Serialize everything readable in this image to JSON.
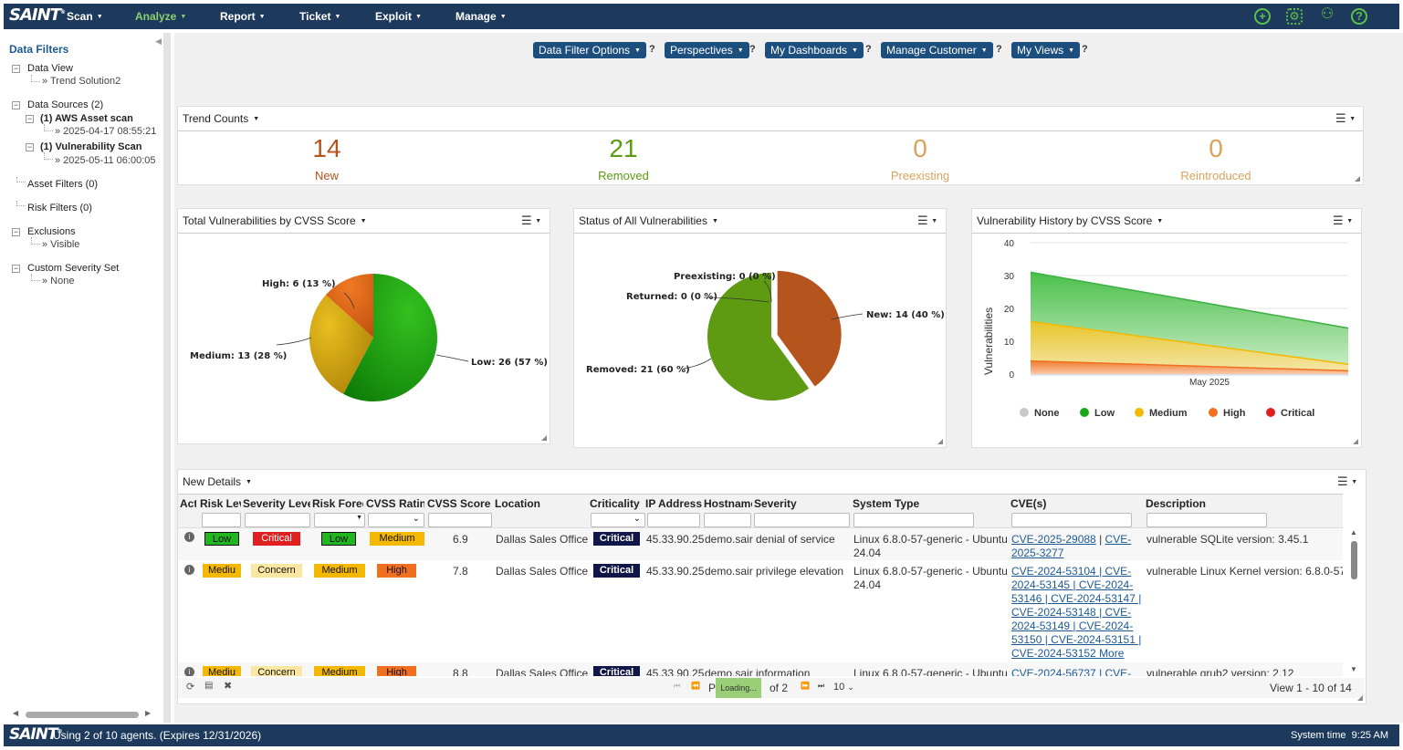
{
  "app": {
    "logo": "SAINT",
    "logo_mark": "®"
  },
  "nav": {
    "items": [
      {
        "label": "Scan"
      },
      {
        "label": "Analyze"
      },
      {
        "label": "Report"
      },
      {
        "label": "Ticket"
      },
      {
        "label": "Exploit"
      },
      {
        "label": "Manage"
      }
    ],
    "active": "Analyze"
  },
  "top_icons": [
    "plus-circle-icon",
    "gear-icon",
    "user-icon",
    "help-icon"
  ],
  "sidebar": {
    "title": "Data Filters",
    "data_view": {
      "label": "Data View",
      "value": "» Trend Solution2"
    },
    "data_sources": {
      "label": "Data Sources (2)",
      "sources": [
        {
          "label": "(1) AWS Asset scan",
          "date": "» 2025-04-17 08:55:21"
        },
        {
          "label": "(1) Vulnerability Scan",
          "date": "» 2025-05-11 06:00:05"
        }
      ]
    },
    "asset_filters": "Asset Filters (0)",
    "risk_filters": "Risk Filters (0)",
    "exclusions": {
      "label": "Exclusions",
      "value": "» Visible"
    },
    "custom_severity": {
      "label": "Custom Severity Set",
      "value": "» None"
    }
  },
  "toolbar": {
    "data_filter_options": "Data Filter Options",
    "perspectives": "Perspectives",
    "my_dashboards": "My Dashboards",
    "manage_customer": "Manage Customer",
    "my_views": "My Views",
    "help": "?"
  },
  "trend_counts": {
    "title": "Trend Counts",
    "items": [
      {
        "value": "14",
        "label": "New",
        "color": "#b5541d"
      },
      {
        "value": "21",
        "label": "Removed",
        "color": "#5e9a12"
      },
      {
        "value": "0",
        "label": "Preexisting",
        "color": "#d9a35c"
      },
      {
        "value": "0",
        "label": "Reintroduced",
        "color": "#d9a35c"
      }
    ]
  },
  "pie1": {
    "title": "Total Vulnerabilities by CVSS Score",
    "labels": {
      "high": "High: 6 (13 %)",
      "medium": "Medium: 13 (28 %)",
      "low": "Low: 26 (57 %)"
    }
  },
  "pie2": {
    "title": "Status of All Vulnerabilities",
    "labels": {
      "preexisting": "Preexisting: 0 (0 %)",
      "returned": "Returned: 0 (0 %)",
      "new": "New: 14 (40 %)",
      "removed": "Removed: 21 (60 %)"
    }
  },
  "history": {
    "title": "Vulnerability History by CVSS Score",
    "ylabel": "Vulnerabilities",
    "yticks": [
      "40",
      "30",
      "20",
      "10",
      "0"
    ],
    "xtick": "May 2025",
    "legend": [
      "None",
      "Low",
      "Medium",
      "High",
      "Critical"
    ]
  },
  "chart_data": [
    {
      "type": "pie",
      "title": "Total Vulnerabilities by CVSS Score",
      "categories": [
        "Low",
        "Medium",
        "High"
      ],
      "values": [
        26,
        13,
        6
      ],
      "percent": [
        57,
        28,
        13
      ],
      "colors": [
        "#1e9e0f",
        "#d4a20a",
        "#e0661a"
      ]
    },
    {
      "type": "pie",
      "title": "Status of All Vulnerabilities",
      "categories": [
        "New",
        "Removed",
        "Preexisting",
        "Returned"
      ],
      "values": [
        14,
        21,
        0,
        0
      ],
      "percent": [
        40,
        60,
        0,
        0
      ],
      "colors": [
        "#b5541d",
        "#5e9a12",
        "#999999",
        "#999999"
      ]
    },
    {
      "type": "area",
      "title": "Vulnerability History by CVSS Score",
      "ylabel": "Vulnerabilities",
      "ylim": [
        0,
        40
      ],
      "xtick": "May 2025",
      "series": [
        {
          "name": "Low",
          "values": [
            31,
            14
          ],
          "color": "#3cb043"
        },
        {
          "name": "Medium",
          "values": [
            16,
            3
          ],
          "color": "#f5b800"
        },
        {
          "name": "High",
          "values": [
            4,
            1
          ],
          "color": "#f07020"
        },
        {
          "name": "Critical",
          "values": [
            0,
            0
          ],
          "color": "#e02020"
        }
      ]
    }
  ],
  "details": {
    "title": "New Details",
    "columns": [
      "Act",
      "Risk Lev",
      "Severity Level",
      "Risk Forec",
      "CVSS Rating",
      "CVSS Score",
      "Location",
      "Criticality",
      "IP Address",
      "Hostname",
      "Severity",
      "System Type",
      "CVE(s)",
      "Description"
    ],
    "rows": [
      {
        "risk": "Low",
        "severity_level": "Critical",
        "forecast": "Low",
        "rating": "Medium",
        "score": "6.9",
        "location": "Dallas Sales Office",
        "criticality": "Critical",
        "ip": "45.33.90.25",
        "host": "demo.sair",
        "severity": "denial of service",
        "system1": "Linux 6.8.0-57-generic - Ubuntu",
        "system2": "24.04",
        "cves": [
          "CVE-2025-29088",
          "|",
          "CVE-",
          "2025-3277"
        ],
        "desc": "vulnerable SQLite version: 3.45.1"
      },
      {
        "risk": "Mediu",
        "severity_level": "Concern",
        "forecast": "Medium",
        "rating": "High",
        "score": "7.8",
        "location": "Dallas Sales Office",
        "criticality": "Critical",
        "ip": "45.33.90.25",
        "host": "demo.sair",
        "severity": "privilege elevation",
        "system1": "Linux 6.8.0-57-generic - Ubuntu",
        "system2": "24.04",
        "cves": [
          "CVE-2024-53104 | CVE-",
          "2024-53145 | CVE-2024-",
          "53146 | CVE-2024-53147 |",
          "CVE-2024-53148 | CVE-",
          "2024-53149 | CVE-2024-",
          "53150 | CVE-2024-53151 |",
          "CVE-2024-53152 More"
        ],
        "desc": "vulnerable Linux Kernel version: 6.8.0-57"
      },
      {
        "risk": "Mediu",
        "severity_level": "Concern",
        "forecast": "Medium",
        "rating": "High",
        "score": "8.8",
        "location": "Dallas Sales Office",
        "criticality": "Critical",
        "ip": "45.33.90.25",
        "host": "demo.sair",
        "severity": "information",
        "system1": "Linux 6.8.0-57-generic - Ubuntu",
        "system2": "",
        "cves": [
          "CVE-2024-56737 | CVE-"
        ],
        "desc": "vulnerable grub2 version: 2.12"
      }
    ],
    "pager": {
      "page_prefix": "P",
      "loading": "Loading...",
      "of": "of 2",
      "rows": "10",
      "view": "View 1 - 10 of 14"
    }
  },
  "footer": {
    "logo": "SAINT",
    "agents": "Using 2 of 10 agents. (Expires 12/31/2026)",
    "time_label": "System time",
    "time": "9:25 AM"
  }
}
